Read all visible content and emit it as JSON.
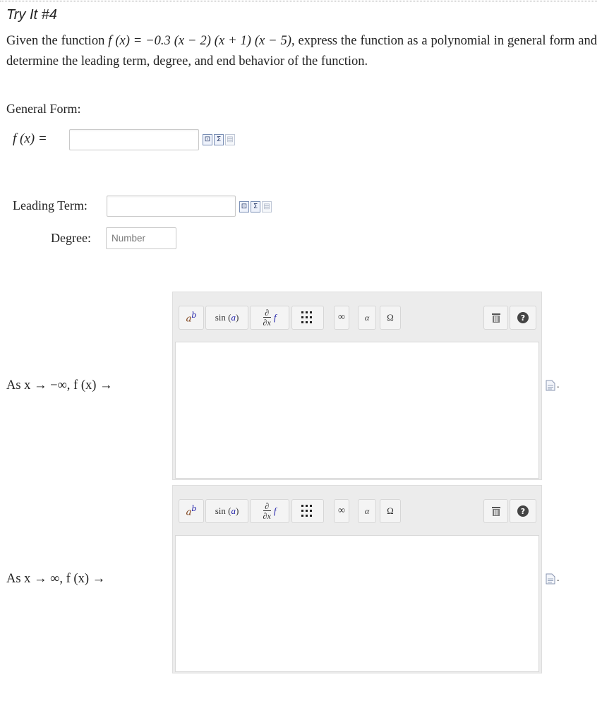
{
  "title": "Try It #4",
  "problem": {
    "prefix": "Given the function ",
    "function_expression": "f (x) = −0.3 (x − 2) (x + 1) (x − 5)",
    "suffix": ", express the function as a polynomial in general form and determine the leading term, degree, and end behavior of the function."
  },
  "general_form": {
    "label": "General Form:",
    "fx_label": "f (x) =",
    "input_value": ""
  },
  "leading_term": {
    "label": "Leading Term:",
    "input_value": ""
  },
  "degree": {
    "label": "Degree:",
    "placeholder": "Number",
    "value": ""
  },
  "end_behavior": {
    "left_label": "As x → −∞, f (x) →",
    "right_label": "As x → ∞, f (x) →"
  },
  "toolbar": {
    "exponent": "a^b",
    "trig": "sin (a)",
    "partial": "∂/∂x f",
    "matrix": "matrix",
    "infinity": "∞",
    "alpha": "α",
    "omega": "Ω",
    "help": "?"
  },
  "icons": {
    "preview": "preview-icon",
    "sigma": "sigma-icon",
    "document": "document-icon",
    "trash": "trash-icon",
    "help": "help-icon"
  }
}
